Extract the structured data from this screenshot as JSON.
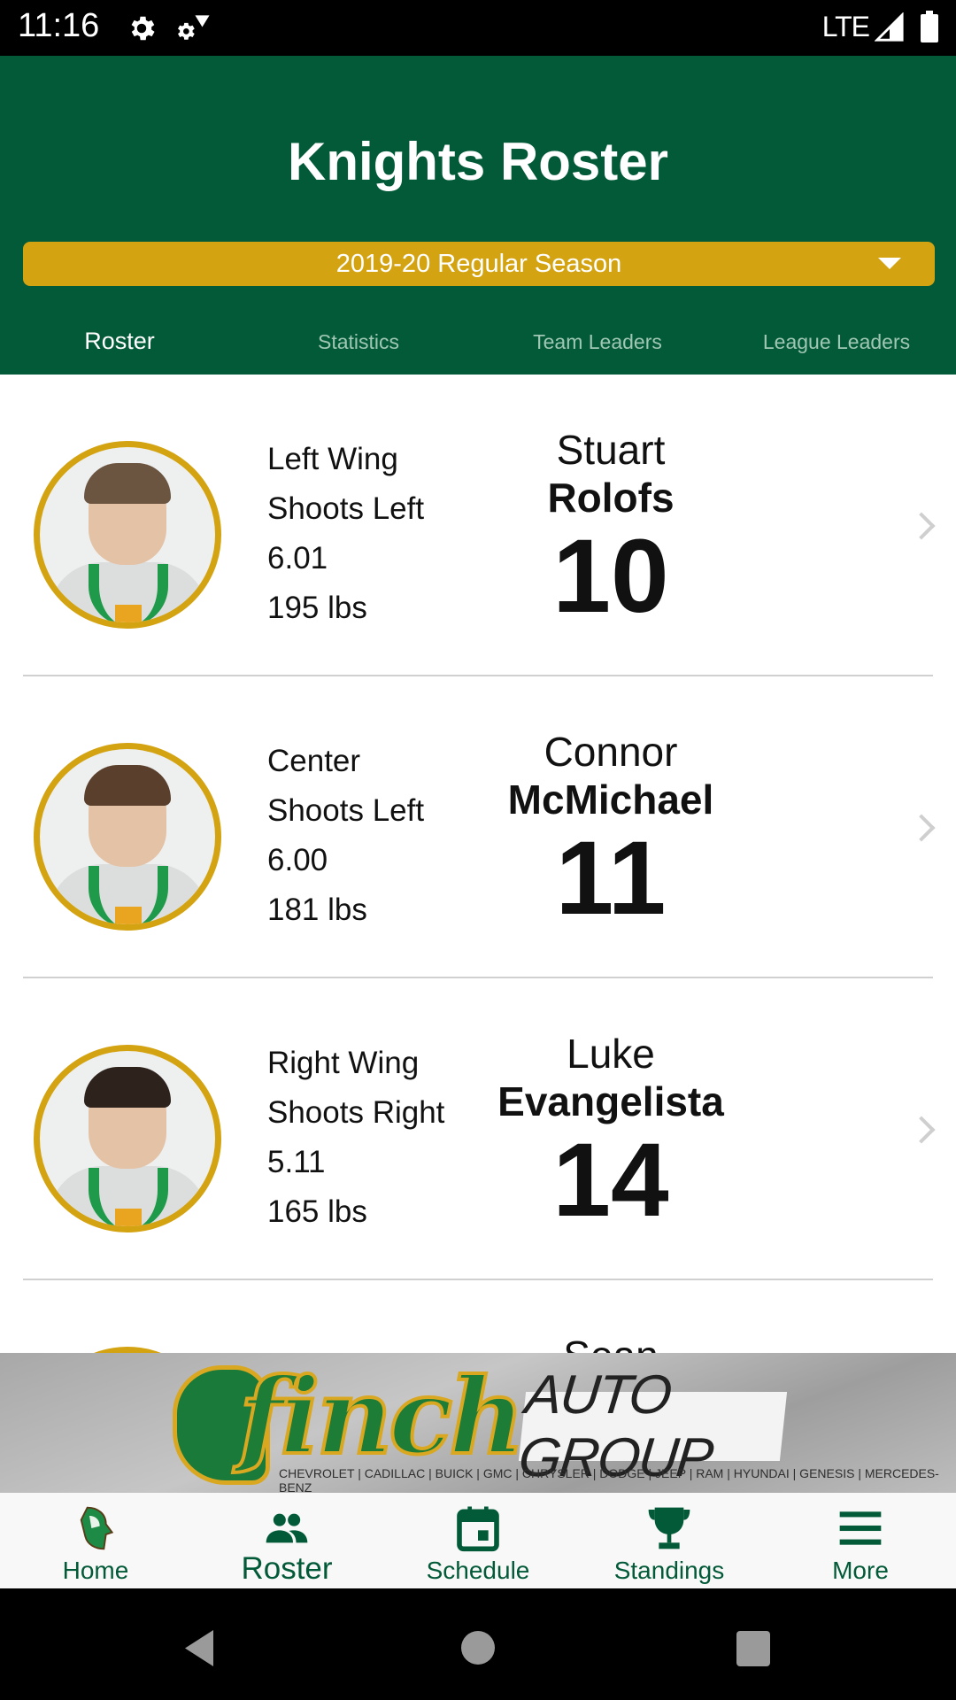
{
  "status_bar": {
    "time": "11:16",
    "icons": [
      "settings-icon",
      "satellite-settings-icon"
    ],
    "network": "LTE",
    "signal_icon": "signal-icon",
    "battery_icon": "battery-icon"
  },
  "header": {
    "title": "Knights Roster",
    "season_select": {
      "selected": "2019-20 Regular Season"
    },
    "colors": {
      "primary": "#035a38",
      "accent": "#d4a312"
    }
  },
  "tabs": [
    {
      "label": "Roster",
      "active": true
    },
    {
      "label": "Statistics",
      "active": false
    },
    {
      "label": "Team Leaders",
      "active": false
    },
    {
      "label": "League Leaders",
      "active": false
    }
  ],
  "players": [
    {
      "position": "Left Wing",
      "shoots": "Shoots Left",
      "height": "6.01",
      "weight": "195 lbs",
      "first_name": "Stuart",
      "last_name": "Rolofs",
      "number": "10"
    },
    {
      "position": "Center",
      "shoots": "Shoots Left",
      "height": "6.00",
      "weight": "181 lbs",
      "first_name": "Connor",
      "last_name": "McMichael",
      "number": "11"
    },
    {
      "position": "Right Wing",
      "shoots": "Shoots Right",
      "height": "5.11",
      "weight": "165 lbs",
      "first_name": "Luke",
      "last_name": "Evangelista",
      "number": "14"
    },
    {
      "position": "",
      "shoots": "",
      "height": "",
      "weight": "",
      "first_name": "Sean",
      "last_name": "",
      "number": ""
    }
  ],
  "ad_banner": {
    "brand": "finch",
    "tagline": "AUTO GROUP",
    "brands": "CHEVROLET | CADILLAC | BUICK | GMC | CHRYSLER | DODGE | JEEP | RAM | HYUNDAI | GENESIS | MERCEDES-BENZ"
  },
  "bottom_nav": [
    {
      "label": "Home",
      "icon": "knight-helmet-icon",
      "active": false
    },
    {
      "label": "Roster",
      "icon": "people-icon",
      "active": true
    },
    {
      "label": "Schedule",
      "icon": "calendar-icon",
      "active": false
    },
    {
      "label": "Standings",
      "icon": "trophy-icon",
      "active": false
    },
    {
      "label": "More",
      "icon": "menu-icon",
      "active": false
    }
  ]
}
